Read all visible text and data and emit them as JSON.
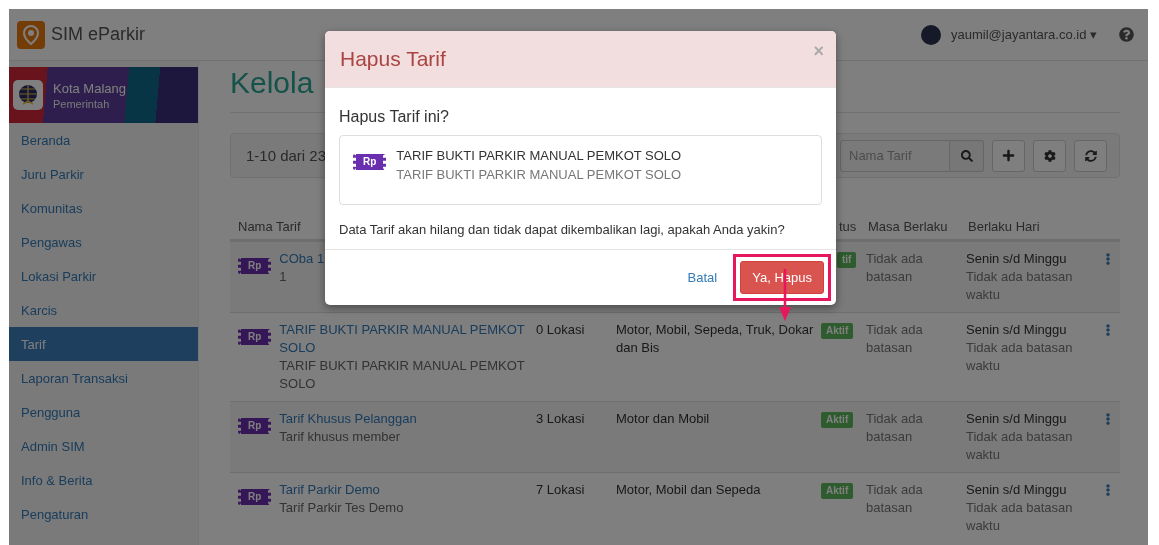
{
  "app": {
    "title": "SIM eParkir"
  },
  "user": {
    "email": "yaumil@jayantara.co.id",
    "caret": "▾"
  },
  "sidebar": {
    "org": {
      "name": "Kota Malang",
      "role": "Pemerintah"
    },
    "items": [
      {
        "label": "Beranda",
        "selected": false
      },
      {
        "label": "Juru Parkir",
        "selected": false
      },
      {
        "label": "Komunitas",
        "selected": false
      },
      {
        "label": "Pengawas",
        "selected": false
      },
      {
        "label": "Lokasi Parkir",
        "selected": false
      },
      {
        "label": "Karcis",
        "selected": false
      },
      {
        "label": "Tarif",
        "selected": true
      },
      {
        "label": "Laporan Transaksi",
        "selected": false
      },
      {
        "label": "Pengguna",
        "selected": false
      },
      {
        "label": "Admin SIM",
        "selected": false
      },
      {
        "label": "Info & Berita",
        "selected": false
      },
      {
        "label": "Pengaturan",
        "selected": false
      }
    ]
  },
  "page": {
    "title": "Kelola",
    "count": "1-10 dari 23",
    "search": {
      "placeholder": "Nama Tarif"
    }
  },
  "table": {
    "columns": [
      "Nama Tarif",
      "tus",
      "Masa Berlaku",
      "Berlaku Hari"
    ],
    "rows": [
      {
        "badge": "Rp",
        "name": "COba 1",
        "description": "1",
        "status": "tif",
        "period": "Tidak ada batasan",
        "days": "Senin s/d Minggu",
        "hours": "Tidak ada batasan waktu"
      },
      {
        "badge": "Rp",
        "name": "TARIF BUKTI PARKIR MANUAL PEMKOT SOLO",
        "description": "TARIF BUKTI PARKIR MANUAL PEMKOT SOLO",
        "locations": "0 Lokasi",
        "vehicles": "Motor, Mobil, Sepeda, Truk, Dokar dan Bis",
        "status": "Aktif",
        "period": "Tidak ada batasan",
        "days": "Senin s/d Minggu",
        "hours": "Tidak ada batasan waktu"
      },
      {
        "badge": "Rp",
        "name": "Tarif Khusus Pelanggan",
        "description": "Tarif khusus member",
        "locations": "3 Lokasi",
        "vehicles": "Motor dan Mobil",
        "status": "Aktif",
        "period": "Tidak ada batasan",
        "days": "Senin s/d Minggu",
        "hours": "Tidak ada batasan waktu"
      },
      {
        "badge": "Rp",
        "name": "Tarif Parkir Demo",
        "description": "Tarif Parkir Tes Demo",
        "locations": "7 Lokasi",
        "vehicles": "Motor, Mobil dan Sepeda",
        "status": "Aktif",
        "period": "Tidak ada batasan",
        "days": "Senin s/d Minggu",
        "hours": "Tidak ada batasan waktu"
      }
    ]
  },
  "dialog": {
    "title": "Hapus Tarif",
    "close": "×",
    "question": "Hapus Tarif ini?",
    "item": {
      "badge": "Rp",
      "name": "TARIF BUKTI PARKIR MANUAL PEMKOT SOLO",
      "description": "TARIF BUKTI PARKIR MANUAL PEMKOT SOLO"
    },
    "warning": "Data Tarif akan hilang dan tidak dapat dikembalikan lagi, apakah Anda yakin?",
    "cancel": "Batal",
    "confirm": "Ya, Hapus"
  }
}
